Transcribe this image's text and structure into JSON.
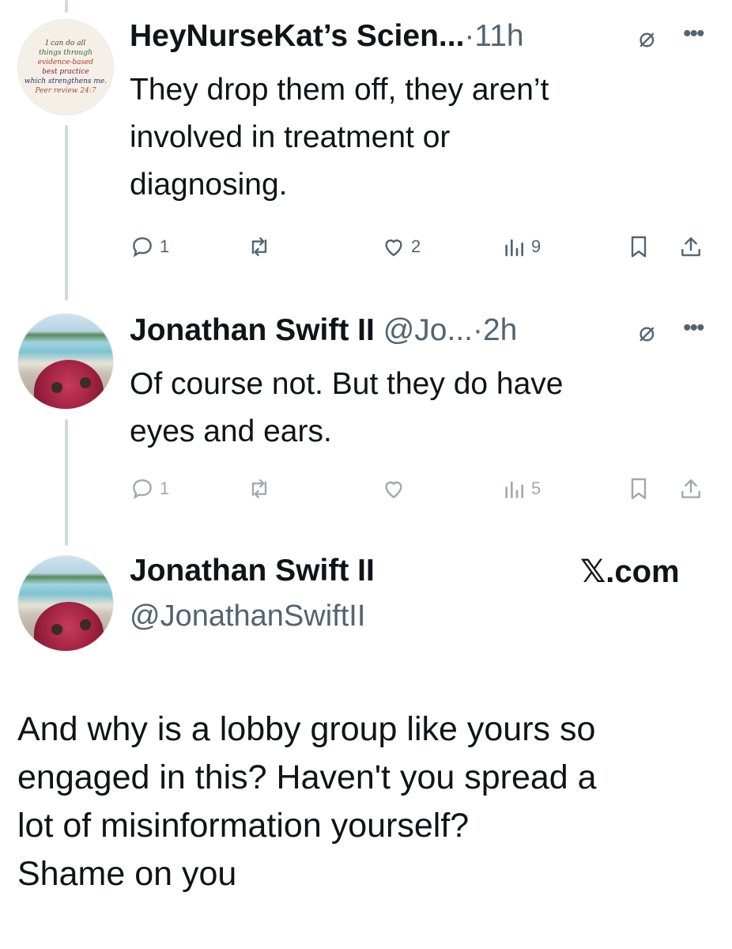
{
  "tweets": [
    {
      "name": "HeyNurseKat’s Scien...",
      "meta": "·11h",
      "text_lines": [
        "They drop them off, they aren’t",
        "involved in treatment or",
        "diagnosing."
      ],
      "replies": "1",
      "likes": "2",
      "views": "9",
      "avatar_text": [
        "I can do all",
        "things through",
        "evidence-based",
        "best practice",
        "which strengthens me.",
        "Peer review 24:7"
      ]
    },
    {
      "name": "Jonathan Swift II",
      "meta": "@Jo...·2h",
      "text_lines": [
        "Of course not. But they do have",
        "eyes and ears."
      ],
      "replies": "1",
      "views": "5"
    }
  ],
  "reply": {
    "name": "Jonathan Swift II",
    "handle": "@JonathanSwiftII",
    "source": "𝕏.com",
    "text_lines": [
      "And why is a lobby group like yours so",
      "engaged in this? Haven't you spread a",
      "lot of misinformation yourself?",
      "Shame on you"
    ]
  },
  "icons": {
    "reply": "reply-icon",
    "retweet": "retweet-icon",
    "like": "heart-icon",
    "views": "views-icon",
    "bookmark": "bookmark-icon",
    "share": "share-icon",
    "grok": "slashed-circle-icon",
    "more": "more-icon"
  },
  "colors": {
    "text": "#0f1419",
    "muted": "#536471",
    "thread_line": "#cfd9de"
  }
}
